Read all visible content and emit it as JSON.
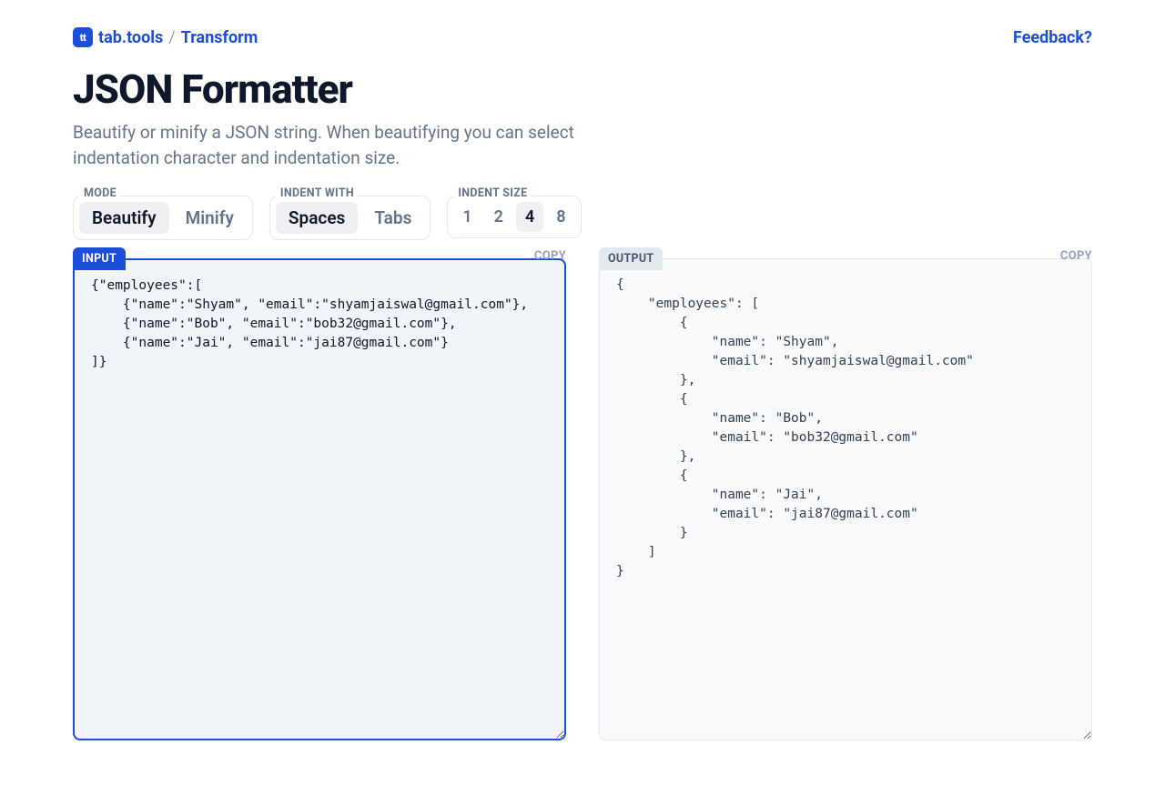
{
  "header": {
    "logo_text": "tt",
    "brand": "tab.tools",
    "slash": "/",
    "crumb": "Transform",
    "feedback": "Feedback?"
  },
  "title": "JSON Formatter",
  "subtitle": "Beautify or minify a JSON string. When beautifying you can select indentation character and indentation size.",
  "controls": {
    "mode": {
      "label": "MODE",
      "options": [
        "Beautify",
        "Minify"
      ],
      "selected": "Beautify"
    },
    "indent_with": {
      "label": "INDENT WITH",
      "options": [
        "Spaces",
        "Tabs"
      ],
      "selected": "Spaces"
    },
    "indent_size": {
      "label": "INDENT SIZE",
      "options": [
        "1",
        "2",
        "4",
        "8"
      ],
      "selected": "4"
    }
  },
  "panes": {
    "input": {
      "tab": "INPUT",
      "copy": "COPY",
      "text": "{\"employees\":[\n    {\"name\":\"Shyam\", \"email\":\"shyamjaiswal@gmail.com\"},\n    {\"name\":\"Bob\", \"email\":\"bob32@gmail.com\"},\n    {\"name\":\"Jai\", \"email\":\"jai87@gmail.com\"}\n]}"
    },
    "output": {
      "tab": "OUTPUT",
      "copy": "COPY",
      "text": "{\n    \"employees\": [\n        {\n            \"name\": \"Shyam\",\n            \"email\": \"shyamjaiswal@gmail.com\"\n        },\n        {\n            \"name\": \"Bob\",\n            \"email\": \"bob32@gmail.com\"\n        },\n        {\n            \"name\": \"Jai\",\n            \"email\": \"jai87@gmail.com\"\n        }\n    ]\n}"
    }
  }
}
